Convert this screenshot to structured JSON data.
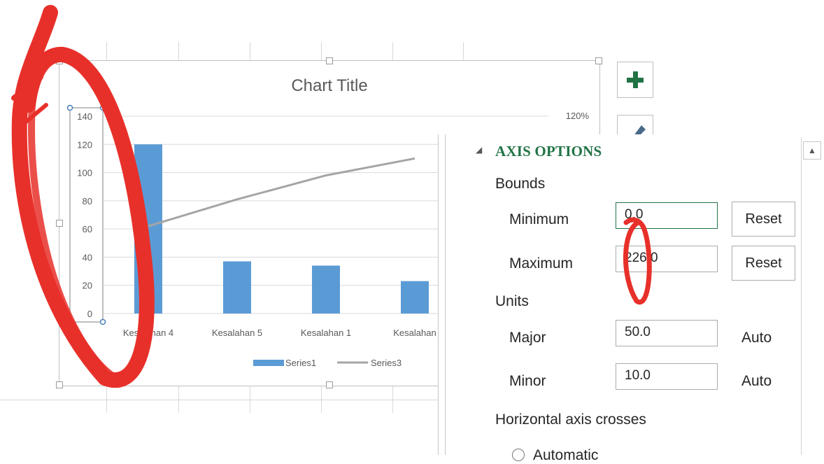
{
  "chart": {
    "title": "Chart Title",
    "secondary_axis_top_label": "120%",
    "chart_data": {
      "type": "bar",
      "categories": [
        "Kesalahan 4",
        "Kesalahan 5",
        "Kesalahan 1",
        "Kesalahan"
      ],
      "series": [
        {
          "name": "Series1",
          "type": "bar",
          "values": [
            120,
            37,
            34,
            23
          ]
        },
        {
          "name": "Series3",
          "type": "line",
          "values": [
            62,
            81,
            98,
            110
          ]
        }
      ],
      "y_ticks": [
        "140",
        "120",
        "100",
        "80",
        "60",
        "40",
        "20",
        "0"
      ],
      "ylim": [
        0,
        140
      ],
      "grid": true,
      "legend_position": "bottom"
    },
    "colors": {
      "bar": "#5b9bd5",
      "line": "#a5a5a5",
      "accent": "#217346"
    }
  },
  "side_buttons": {
    "add_icon": "plus-icon",
    "style_icon": "paintbrush-icon"
  },
  "panel": {
    "section_title": "AXIS OPTIONS",
    "bounds_label": "Bounds",
    "minimum_label": "Minimum",
    "minimum_value": "0.0",
    "maximum_label": "Maximum",
    "maximum_value": "226.0",
    "reset_label": "Reset",
    "units_label": "Units",
    "major_label": "Major",
    "major_value": "50.0",
    "minor_label": "Minor",
    "minor_value": "10.0",
    "auto_label": "Auto",
    "horizontal_crosses_label": "Horizontal axis crosses",
    "automatic_label": "Automatic"
  }
}
